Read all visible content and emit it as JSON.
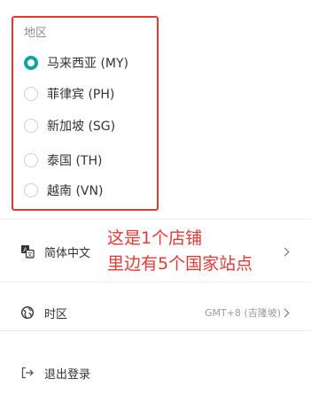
{
  "region": {
    "title": "地区",
    "options": [
      {
        "label": "马来西亚 (MY)",
        "selected": true
      },
      {
        "label": "菲律宾 (PH)",
        "selected": false
      },
      {
        "label": "新加坡 (SG)",
        "selected": false
      },
      {
        "label": "泰国 (TH)",
        "selected": false
      },
      {
        "label": "越南 (VN)",
        "selected": false
      }
    ]
  },
  "annotation": {
    "line1": "这是1个店铺",
    "line2": "里边有5个国家站点",
    "color": "#e53935"
  },
  "menu": {
    "language": {
      "label": "简体中文",
      "icon": "translate-icon"
    },
    "timezone": {
      "label": "时区",
      "value": "GMT+8 (吉隆坡)",
      "icon": "globe-icon"
    },
    "logout": {
      "label": "退出登录",
      "icon": "logout-icon"
    }
  },
  "colors": {
    "accent": "#0fa3a3",
    "highlight": "#e53935"
  }
}
